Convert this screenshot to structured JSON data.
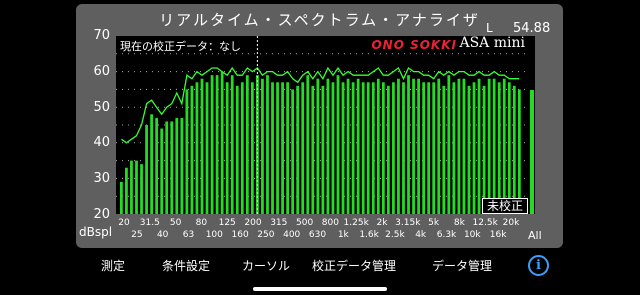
{
  "app": {
    "title": "リアルタイム・スペクトラム・アナライザ",
    "channel_label": "L",
    "all_value": "54.88",
    "calibration_text": "現在の校正データ：なし",
    "brand": "ONO SOKKI",
    "model": "ASA mini",
    "uncalibrated_badge": "未校正",
    "y_unit": "dBspl",
    "all_label": "All"
  },
  "tabs": [
    {
      "label": "測定"
    },
    {
      "label": "条件設定"
    },
    {
      "label": "カーソル"
    },
    {
      "label": "校正データ管理"
    },
    {
      "label": "データ管理"
    }
  ],
  "colors": {
    "bar": "#22dd22",
    "line": "#33ff33",
    "panel": "#5f5f5f",
    "info": "#3aa0ff"
  },
  "chart_data": {
    "type": "bar",
    "ylim": [
      20,
      70
    ],
    "yticks": [
      "70",
      "60",
      "50",
      "40",
      "30",
      "20"
    ],
    "tick_labels_top": [
      "20",
      "31.5",
      "50",
      "80",
      "125",
      "200",
      "315",
      "500",
      "800",
      "1.25k",
      "2k",
      "3.15k",
      "5k",
      "8k",
      "12.5k",
      "20k"
    ],
    "tick_labels_bottom": [
      "25",
      "40",
      "63",
      "100",
      "160",
      "250",
      "400",
      "630",
      "1k",
      "1.6k",
      "2.5k",
      "4k",
      "6.3k",
      "10k",
      "16k"
    ],
    "series": [
      {
        "values": [
          29,
          33,
          35,
          35,
          34,
          45,
          48,
          47,
          44,
          46,
          46,
          47,
          47,
          55,
          56,
          57,
          58,
          57,
          59,
          59,
          60,
          57,
          59,
          56,
          57,
          59,
          57,
          59,
          58,
          59,
          57,
          57,
          57,
          57,
          55,
          56,
          57,
          59,
          56,
          58,
          56,
          58,
          57,
          59,
          57,
          58,
          57,
          58,
          57,
          57,
          57,
          58,
          57,
          56,
          57,
          58,
          57,
          59,
          58,
          58,
          57,
          57,
          57,
          58,
          56,
          59,
          57,
          58,
          58,
          56,
          57,
          58,
          56,
          58,
          58,
          57,
          58,
          57,
          56,
          55
        ]
      },
      {
        "values": [
          41,
          40,
          41,
          42,
          45,
          51,
          52,
          50,
          48,
          50,
          51,
          54,
          51,
          59,
          58,
          60,
          59,
          60,
          61,
          61,
          60,
          59,
          61,
          59,
          59,
          61,
          60,
          61,
          59,
          60,
          60,
          59,
          59,
          60,
          58,
          57,
          59,
          60,
          58,
          60,
          58,
          61,
          59,
          61,
          59,
          60,
          59,
          59,
          59,
          59,
          60,
          61,
          59,
          59,
          60,
          61,
          58,
          61,
          60,
          60,
          59,
          59,
          58,
          60,
          59,
          60,
          59,
          60,
          60,
          59,
          59,
          60,
          59,
          59,
          60,
          59,
          59,
          58,
          58,
          58
        ]
      }
    ],
    "all_level": 54.88,
    "cursor_index": 27
  }
}
